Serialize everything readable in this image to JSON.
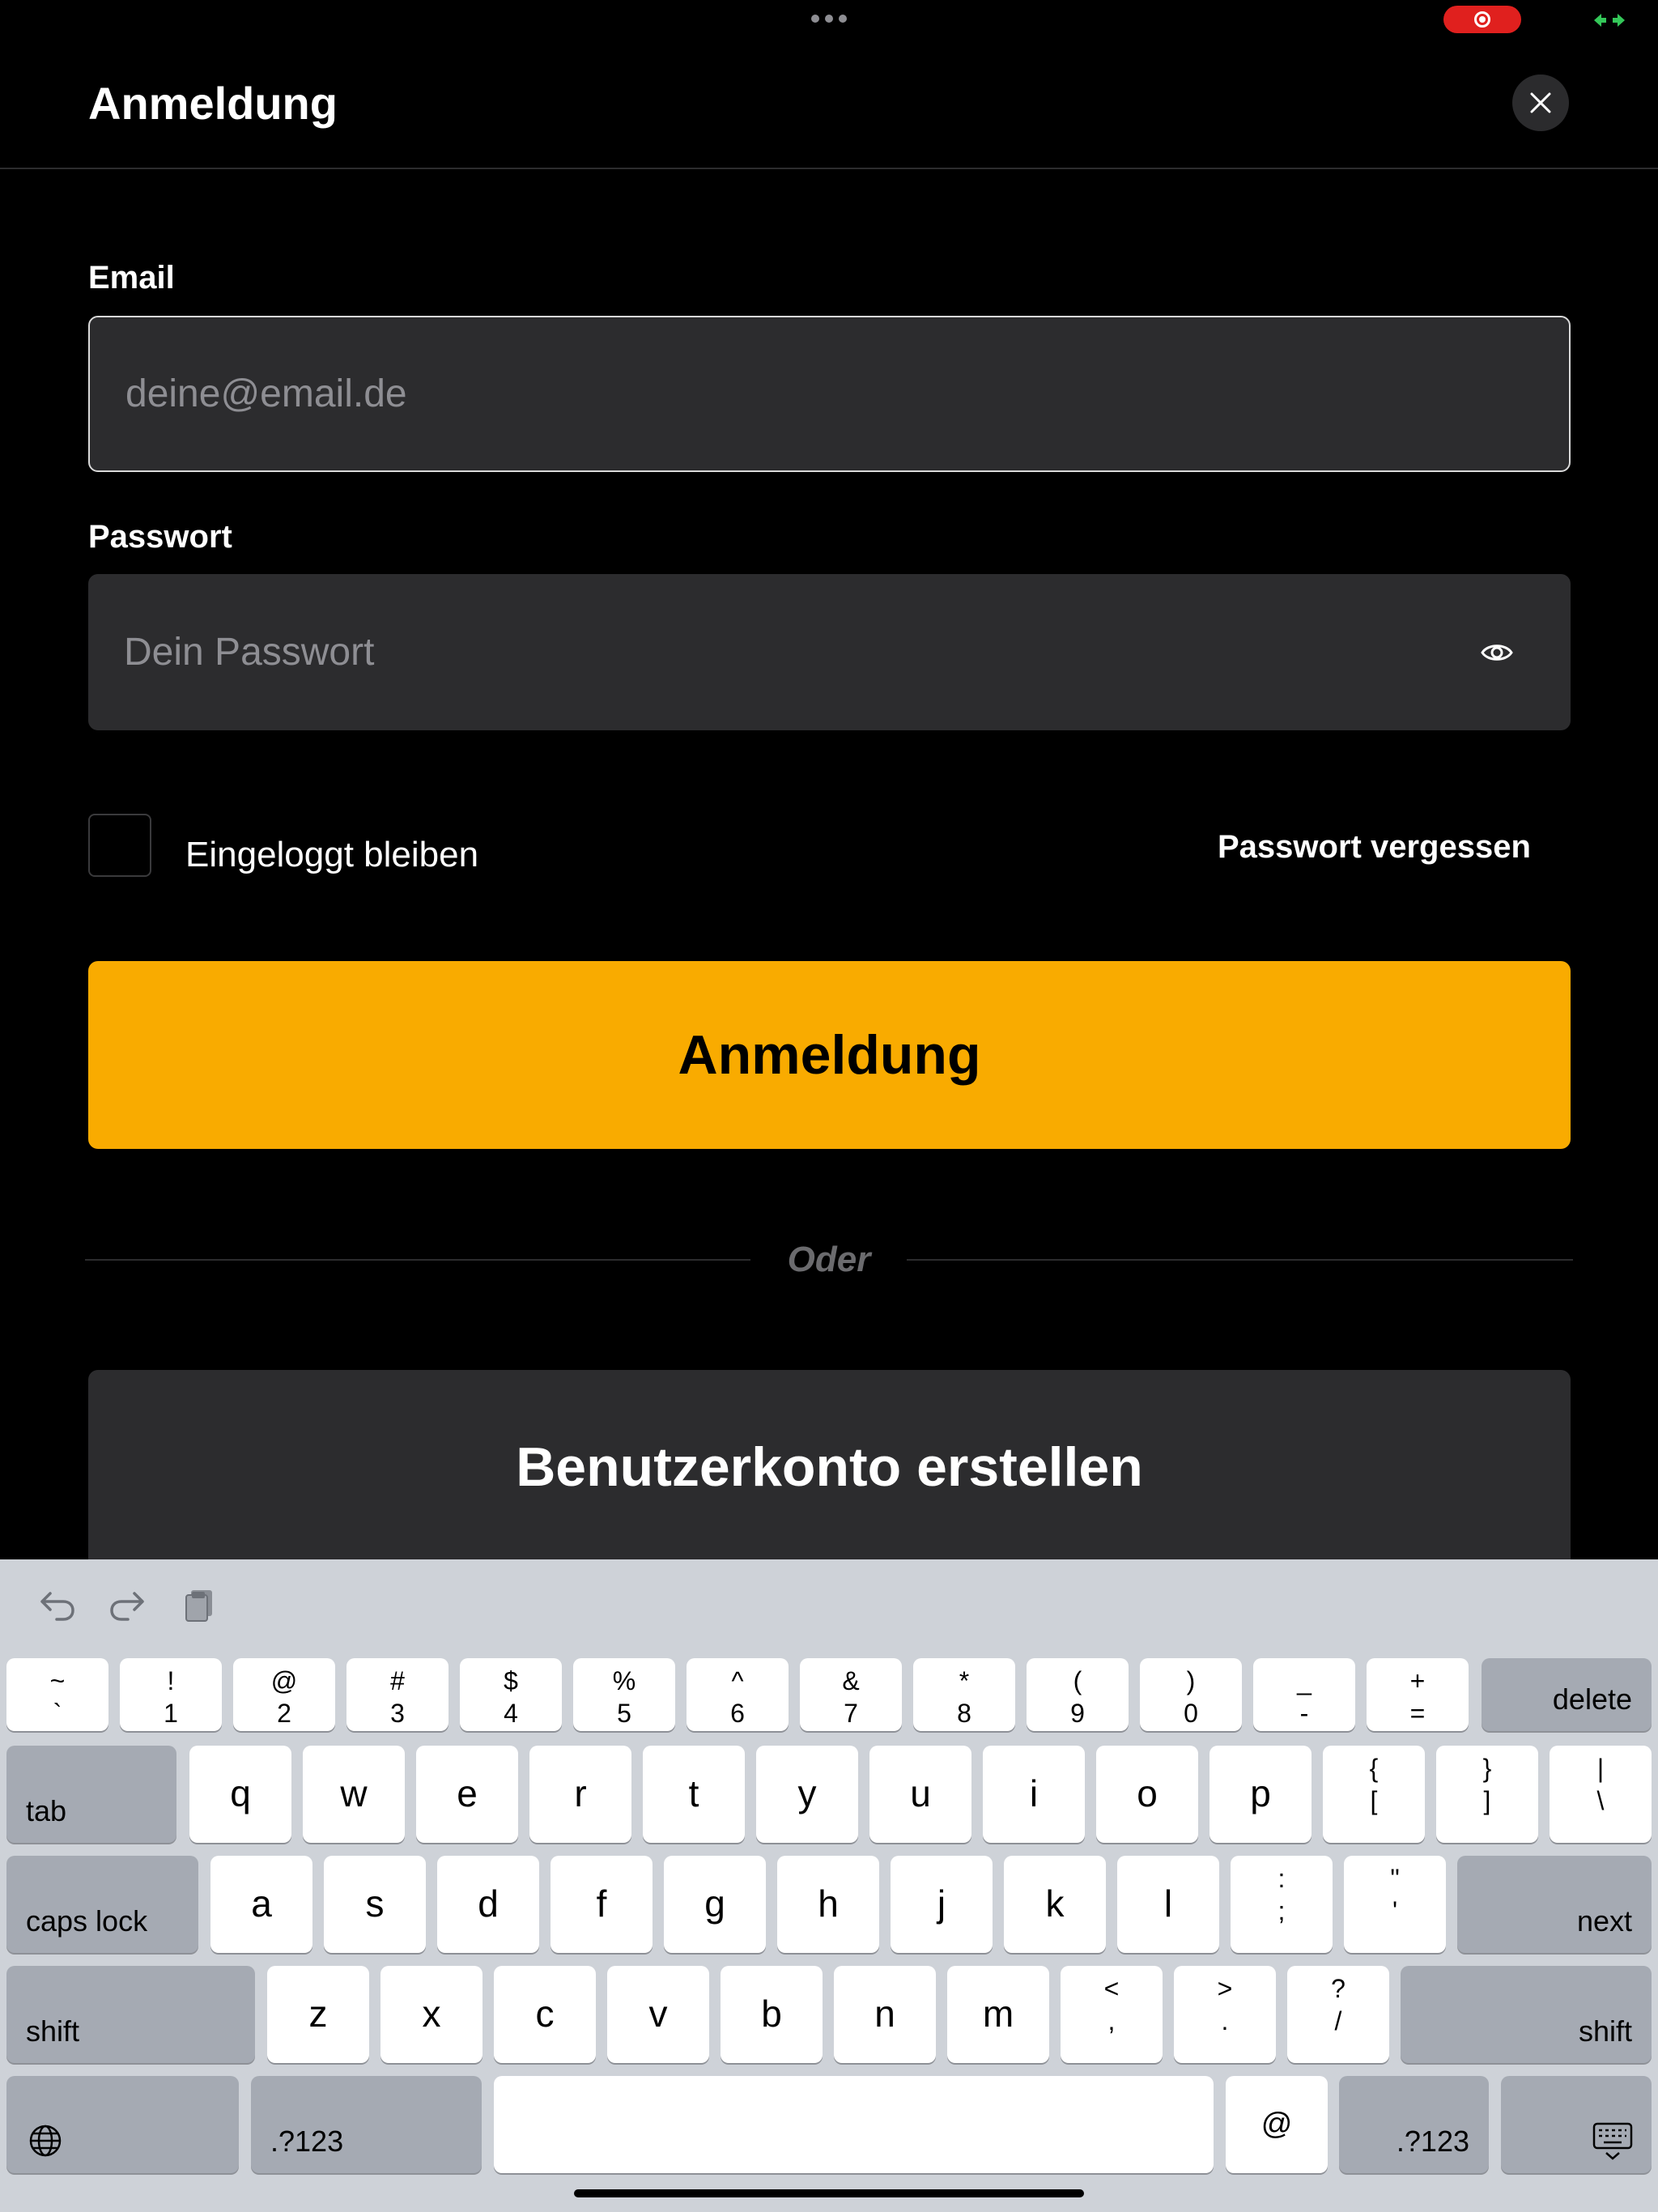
{
  "header": {
    "title": "Anmeldung"
  },
  "form": {
    "email_label": "Email",
    "email_placeholder": "deine@email.de",
    "password_label": "Passwort",
    "password_placeholder": "Dein Passwort",
    "remember_label": "Eingeloggt bleiben",
    "remember_checked": false,
    "forgot_label": "Passwort vergessen",
    "login_button": "Anmeldung",
    "divider_text": "Oder",
    "register_button": "Benutzerkonto erstellen"
  },
  "colors": {
    "accent": "#f9ab00",
    "background": "#000000",
    "field": "#2c2c2e",
    "recording": "#e0201e"
  },
  "keyboard": {
    "row1": [
      {
        "top": "~",
        "bottom": "`"
      },
      {
        "top": "!",
        "bottom": "1"
      },
      {
        "top": "@",
        "bottom": "2"
      },
      {
        "top": "#",
        "bottom": "3"
      },
      {
        "top": "$",
        "bottom": "4"
      },
      {
        "top": "%",
        "bottom": "5"
      },
      {
        "top": "^",
        "bottom": "6"
      },
      {
        "top": "&",
        "bottom": "7"
      },
      {
        "top": "*",
        "bottom": "8"
      },
      {
        "top": "(",
        "bottom": "9"
      },
      {
        "top": ")",
        "bottom": "0"
      },
      {
        "top": "_",
        "bottom": "-"
      },
      {
        "top": "+",
        "bottom": "="
      }
    ],
    "delete": "delete",
    "tab": "tab",
    "row2": [
      "q",
      "w",
      "e",
      "r",
      "t",
      "y",
      "u",
      "i",
      "o",
      "p"
    ],
    "row2_sym": [
      {
        "top": "{",
        "bottom": "["
      },
      {
        "top": "}",
        "bottom": "]"
      },
      {
        "top": "|",
        "bottom": "\\"
      }
    ],
    "caps_lock": "caps lock",
    "row3": [
      "a",
      "s",
      "d",
      "f",
      "g",
      "h",
      "j",
      "k",
      "l"
    ],
    "row3_sym": [
      {
        "top": ":",
        "bottom": ";"
      },
      {
        "top": "\"",
        "bottom": "'"
      }
    ],
    "next": "next",
    "shift": "shift",
    "row4": [
      "z",
      "x",
      "c",
      "v",
      "b",
      "n",
      "m"
    ],
    "row4_sym": [
      {
        "top": "<",
        "bottom": ","
      },
      {
        "top": ">",
        "bottom": "."
      },
      {
        "top": "?",
        "bottom": "/"
      }
    ],
    "numbers": ".?123",
    "at": "@",
    "icons": [
      "globe-icon",
      "keyboard-dismiss-icon",
      "undo-icon",
      "redo-icon",
      "clipboard-icon"
    ]
  }
}
